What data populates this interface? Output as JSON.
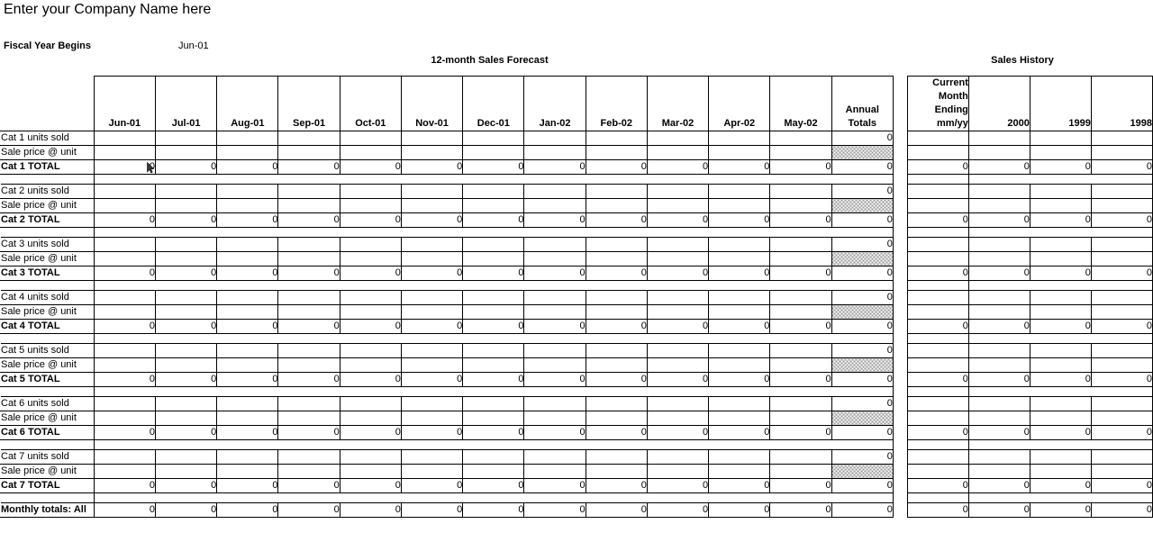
{
  "document": {
    "company_title": "Enter your Company Name here",
    "fiscal_year_label": "Fiscal Year Begins",
    "fiscal_year_value": "Jun-01",
    "forecast_caption": "12-month Sales Forecast",
    "history_caption": "Sales History"
  },
  "forecast": {
    "month_headers": [
      "Jun-01",
      "Jul-01",
      "Aug-01",
      "Sep-01",
      "Oct-01",
      "Nov-01",
      "Dec-01",
      "Jan-02",
      "Feb-02",
      "Mar-02",
      "Apr-02",
      "May-02"
    ],
    "annual_totals_header": "Annual\nTotals"
  },
  "history": {
    "headers": [
      "Current\nMonth\nEnding\nmm/yy",
      "2000",
      "1999",
      "1998"
    ]
  },
  "row_labels": {
    "units_sold": [
      "Cat 1 units sold",
      "Cat 2 units sold",
      "Cat 3 units sold",
      "Cat 4 units sold",
      "Cat 5 units sold",
      "Cat 6 units sold",
      "Cat 7 units sold"
    ],
    "sale_price": "Sale price @ unit",
    "totals": [
      "Cat 1 TOTAL",
      "Cat 2 TOTAL",
      "Cat 3 TOTAL",
      "Cat 4 TOTAL",
      "Cat 5 TOTAL",
      "Cat 6 TOTAL",
      "Cat 7 TOTAL"
    ],
    "monthly_totals": "Monthly totals: All"
  },
  "categories": [
    {
      "name": "Cat 1",
      "units_sold": {
        "months": [
          "",
          "",
          "",
          "",
          "",
          "",
          "",
          "",
          "",
          "",
          "",
          ""
        ],
        "annual": "0",
        "history": [
          "",
          "",
          "",
          ""
        ]
      },
      "sale_price": {
        "months": [
          "",
          "",
          "",
          "",
          "",
          "",
          "",
          "",
          "",
          "",
          "",
          ""
        ],
        "annual": "",
        "history": [
          "",
          "",
          "",
          ""
        ]
      },
      "total": {
        "months": [
          "0",
          "0",
          "0",
          "0",
          "0",
          "0",
          "0",
          "0",
          "0",
          "0",
          "0",
          "0"
        ],
        "annual": "0",
        "history": [
          "0",
          "0",
          "0",
          "0"
        ]
      }
    },
    {
      "name": "Cat 2",
      "units_sold": {
        "months": [
          "",
          "",
          "",
          "",
          "",
          "",
          "",
          "",
          "",
          "",
          "",
          ""
        ],
        "annual": "0",
        "history": [
          "",
          "",
          "",
          ""
        ]
      },
      "sale_price": {
        "months": [
          "",
          "",
          "",
          "",
          "",
          "",
          "",
          "",
          "",
          "",
          "",
          ""
        ],
        "annual": "",
        "history": [
          "",
          "",
          "",
          ""
        ]
      },
      "total": {
        "months": [
          "0",
          "0",
          "0",
          "0",
          "0",
          "0",
          "0",
          "0",
          "0",
          "0",
          "0",
          "0"
        ],
        "annual": "0",
        "history": [
          "0",
          "0",
          "0",
          "0"
        ]
      }
    },
    {
      "name": "Cat 3",
      "units_sold": {
        "months": [
          "",
          "",
          "",
          "",
          "",
          "",
          "",
          "",
          "",
          "",
          "",
          ""
        ],
        "annual": "0",
        "history": [
          "",
          "",
          "",
          ""
        ]
      },
      "sale_price": {
        "months": [
          "",
          "",
          "",
          "",
          "",
          "",
          "",
          "",
          "",
          "",
          "",
          ""
        ],
        "annual": "",
        "history": [
          "",
          "",
          "",
          ""
        ]
      },
      "total": {
        "months": [
          "0",
          "0",
          "0",
          "0",
          "0",
          "0",
          "0",
          "0",
          "0",
          "0",
          "0",
          "0"
        ],
        "annual": "0",
        "history": [
          "0",
          "0",
          "0",
          "0"
        ]
      }
    },
    {
      "name": "Cat 4",
      "units_sold": {
        "months": [
          "",
          "",
          "",
          "",
          "",
          "",
          "",
          "",
          "",
          "",
          "",
          ""
        ],
        "annual": "0",
        "history": [
          "",
          "",
          "",
          ""
        ]
      },
      "sale_price": {
        "months": [
          "",
          "",
          "",
          "",
          "",
          "",
          "",
          "",
          "",
          "",
          "",
          ""
        ],
        "annual": "",
        "history": [
          "",
          "",
          "",
          ""
        ]
      },
      "total": {
        "months": [
          "0",
          "0",
          "0",
          "0",
          "0",
          "0",
          "0",
          "0",
          "0",
          "0",
          "0",
          "0"
        ],
        "annual": "0",
        "history": [
          "0",
          "0",
          "0",
          "0"
        ]
      }
    },
    {
      "name": "Cat 5",
      "units_sold": {
        "months": [
          "",
          "",
          "",
          "",
          "",
          "",
          "",
          "",
          "",
          "",
          "",
          ""
        ],
        "annual": "0",
        "history": [
          "",
          "",
          "",
          ""
        ]
      },
      "sale_price": {
        "months": [
          "",
          "",
          "",
          "",
          "",
          "",
          "",
          "",
          "",
          "",
          "",
          ""
        ],
        "annual": "",
        "history": [
          "",
          "",
          "",
          ""
        ]
      },
      "total": {
        "months": [
          "0",
          "0",
          "0",
          "0",
          "0",
          "0",
          "0",
          "0",
          "0",
          "0",
          "0",
          "0"
        ],
        "annual": "0",
        "history": [
          "0",
          "0",
          "0",
          "0"
        ]
      }
    },
    {
      "name": "Cat 6",
      "units_sold": {
        "months": [
          "",
          "",
          "",
          "",
          "",
          "",
          "",
          "",
          "",
          "",
          "",
          ""
        ],
        "annual": "0",
        "history": [
          "",
          "",
          "",
          ""
        ]
      },
      "sale_price": {
        "months": [
          "",
          "",
          "",
          "",
          "",
          "",
          "",
          "",
          "",
          "",
          "",
          ""
        ],
        "annual": "",
        "history": [
          "",
          "",
          "",
          ""
        ]
      },
      "total": {
        "months": [
          "0",
          "0",
          "0",
          "0",
          "0",
          "0",
          "0",
          "0",
          "0",
          "0",
          "0",
          "0"
        ],
        "annual": "0",
        "history": [
          "0",
          "0",
          "0",
          "0"
        ]
      }
    },
    {
      "name": "Cat 7",
      "units_sold": {
        "months": [
          "",
          "",
          "",
          "",
          "",
          "",
          "",
          "",
          "",
          "",
          "",
          ""
        ],
        "annual": "0",
        "history": [
          "",
          "",
          "",
          ""
        ]
      },
      "sale_price": {
        "months": [
          "",
          "",
          "",
          "",
          "",
          "",
          "",
          "",
          "",
          "",
          "",
          ""
        ],
        "annual": "",
        "history": [
          "",
          "",
          "",
          ""
        ]
      },
      "total": {
        "months": [
          "0",
          "0",
          "0",
          "0",
          "0",
          "0",
          "0",
          "0",
          "0",
          "0",
          "0",
          "0"
        ],
        "annual": "0",
        "history": [
          "0",
          "0",
          "0",
          "0"
        ]
      }
    }
  ],
  "grand_total": {
    "months": [
      "0",
      "0",
      "0",
      "0",
      "0",
      "0",
      "0",
      "0",
      "0",
      "0",
      "0",
      "0"
    ],
    "annual": "0",
    "history": [
      "0",
      "0",
      "0",
      "0"
    ]
  },
  "colors": {
    "grid_line": "#000000",
    "hatch": "#9a9a9a",
    "background": "#ffffff"
  }
}
